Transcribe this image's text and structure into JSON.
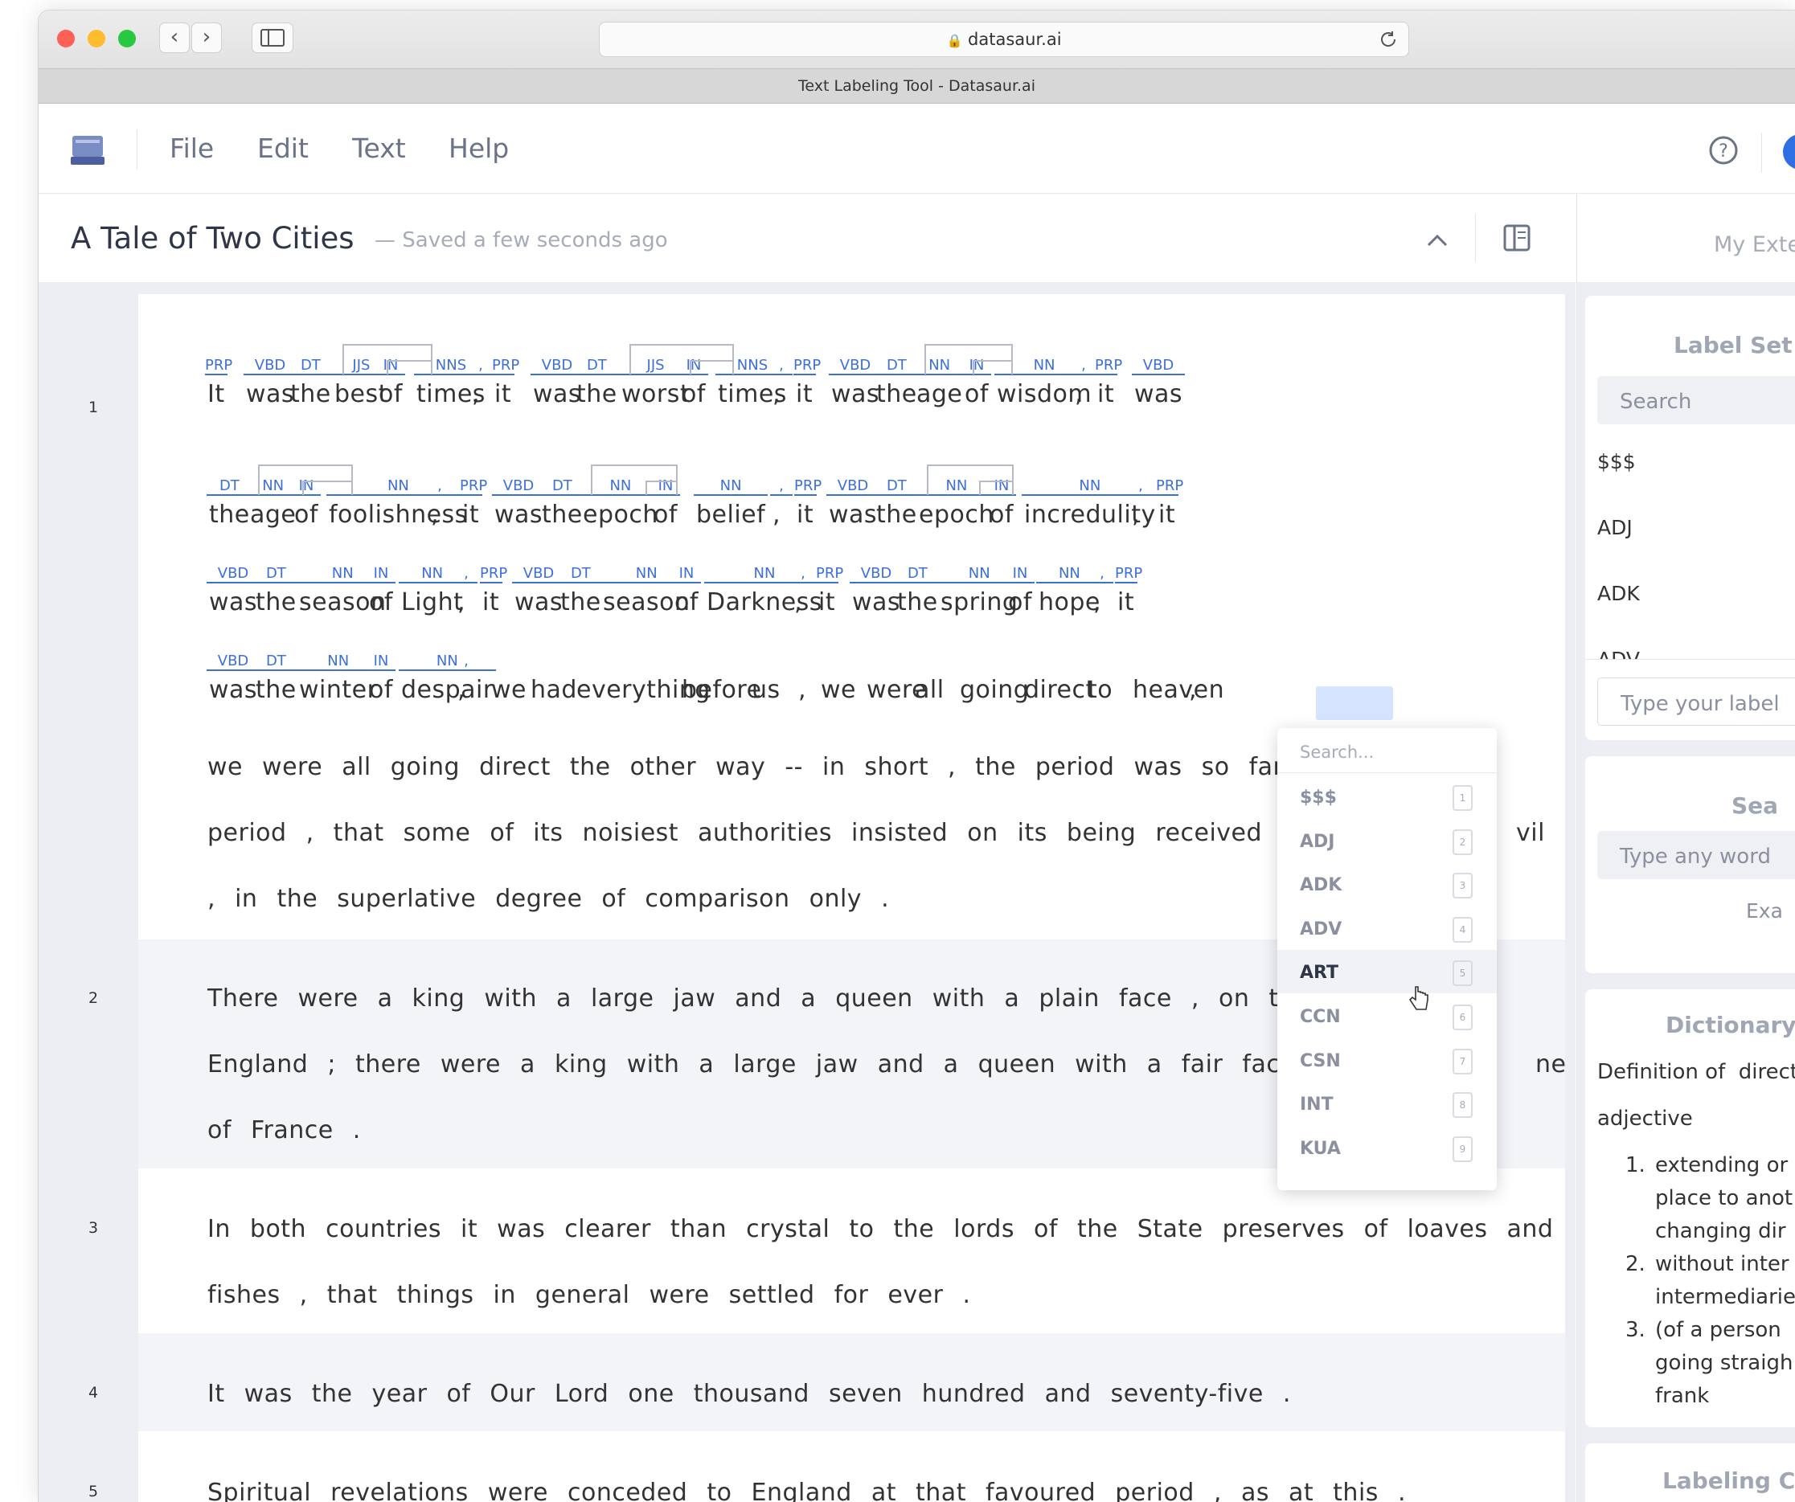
{
  "browser": {
    "url": "datasaur.ai",
    "tab_title": "Text Labeling Tool - Datasaur.ai"
  },
  "menu": [
    "File",
    "Edit",
    "Text",
    "Help"
  ],
  "document": {
    "title": "A Tale of Two Cities",
    "saved_status": "— Saved a few seconds ago"
  },
  "colors": {
    "label_blue": "#3d6fd9",
    "highlight": "#d6e4ff",
    "gutter": "#eceef3"
  },
  "row_numbers": [
    "1",
    "2",
    "3",
    "4",
    "5"
  ],
  "line1": {
    "tokens": [
      "It",
      "was",
      "the",
      "best",
      "of",
      "times",
      ",",
      "it",
      "was",
      "the",
      "worst",
      "of",
      "times",
      ",",
      "it",
      "was",
      "the",
      "age",
      "of",
      "wisdom",
      ",",
      "it",
      "was"
    ],
    "labels": [
      "PRP",
      "VBD",
      "DT",
      "JJS",
      "IN",
      "NNS",
      ",",
      "PRP",
      "VBD",
      "DT",
      "JJS",
      "IN",
      "NNS",
      ",",
      "PRP",
      "VBD",
      "DT",
      "NN",
      "IN",
      "NN",
      ",",
      "PRP",
      "VBD"
    ]
  },
  "line2": {
    "tokens": [
      "the",
      "age",
      "of",
      "foolishness",
      ",",
      "it",
      "was",
      "the",
      "epoch",
      "of",
      "belief",
      ",",
      "it",
      "was",
      "the",
      "epoch",
      "of",
      "incredulity",
      ",",
      "it"
    ],
    "labels": [
      "DT",
      "NN",
      "IN",
      "NN",
      ",",
      "PRP",
      "VBD",
      "DT",
      "NN",
      "IN",
      "NN",
      ",",
      "PRP",
      "VBD",
      "DT",
      "NN",
      "IN",
      "NN",
      ",",
      "PRP"
    ]
  },
  "line3": {
    "tokens": [
      "was",
      "the",
      "season",
      "of",
      "Light",
      ",",
      "it",
      "was",
      "the",
      "season",
      "of",
      "Darkness",
      ",",
      "it",
      "was",
      "the",
      "spring",
      "of",
      "hope",
      ",",
      "it"
    ],
    "labels": [
      "VBD",
      "DT",
      "NN",
      "IN",
      "NN",
      ",",
      "PRP",
      "VBD",
      "DT",
      "NN",
      "IN",
      "NN",
      ",",
      "PRP",
      "VBD",
      "DT",
      "NN",
      "IN",
      "NN",
      ",",
      "PRP"
    ]
  },
  "line4": {
    "tokens": [
      "was",
      "the",
      "winter",
      "of",
      "despair",
      ",",
      "we",
      "had",
      "everything",
      "before",
      "us",
      ",",
      "we",
      "were",
      "all",
      "going",
      "direct",
      "to",
      "heaven",
      ","
    ],
    "labels": [
      "VBD",
      "DT",
      "NN",
      "IN",
      "NN",
      ","
    ]
  },
  "plain_lines": [
    {
      "text": "we  were  all  going  direct  the  other  way  --  in  short  ,  the  period  was  so  far  li"
    },
    {
      "text": "period  ,  that  some  of  its  noisiest  authorities  insisted  on  its  being  received  ,  for"
    },
    {
      "text": ",  in  the  superlative  degree  of  comparison  only  ."
    },
    {
      "text": "There  were  a  king  with  a  large  jaw  and  a  queen  with  a  plain  face  ,  on  th"
    },
    {
      "text": "England  ;  there  were  a  king  with  a  large  jaw  and  a  queen  with  a  fair  face"
    },
    {
      "text": "of  France  ."
    },
    {
      "text": "In  both  countries  it  was  clearer  than  crystal  to  the  lords  of  the  State  preserves  of  loaves  and"
    },
    {
      "text": "fishes  ,  that  things  in  general  were  settled  for  ever  ."
    },
    {
      "text": "It  was  the  year  of  Our  Lord  one  thousand  seven  hundred  and  seventy-five  ."
    },
    {
      "text": "Spiritual  revelations  were  conceded  to  England  at  that  favoured  period  ,  as  at  this  ."
    }
  ],
  "tail_fragments": {
    "evil": "vil",
    "ne": "ne"
  },
  "dropdown": {
    "placeholder": "Search...",
    "options": [
      {
        "label": "$$$",
        "key": "1"
      },
      {
        "label": "ADJ",
        "key": "2"
      },
      {
        "label": "ADK",
        "key": "3"
      },
      {
        "label": "ADV",
        "key": "4"
      },
      {
        "label": "ART",
        "key": "5"
      },
      {
        "label": "CCN",
        "key": "6"
      },
      {
        "label": "CSN",
        "key": "7"
      },
      {
        "label": "INT",
        "key": "8"
      },
      {
        "label": "KUA",
        "key": "9"
      }
    ],
    "hovered": "ART"
  },
  "sidebar": {
    "tab": "My Exte",
    "label_set_title": "Label Set",
    "search_placeholder": "Search",
    "labels": [
      "$$$",
      "ADJ",
      "ADK",
      "ADV"
    ],
    "type_label_placeholder": "Type your label",
    "search_title": "Sea",
    "search_word_placeholder": "Type any word",
    "example_text": "Exa",
    "dictionary_title": "Dictionary",
    "definition_prefix": "Definition of",
    "definition_word": "direct",
    "pos": "adjective",
    "definitions": [
      {
        "num": "1.",
        "lines": [
          "extending or",
          "place to anot",
          "changing dir"
        ]
      },
      {
        "num": "2.",
        "lines": [
          "without inter",
          "intermediarie"
        ]
      },
      {
        "num": "3.",
        "lines": [
          "(of a person",
          "going straigh",
          "frank"
        ]
      }
    ],
    "labeling_title": "Labeling C"
  }
}
